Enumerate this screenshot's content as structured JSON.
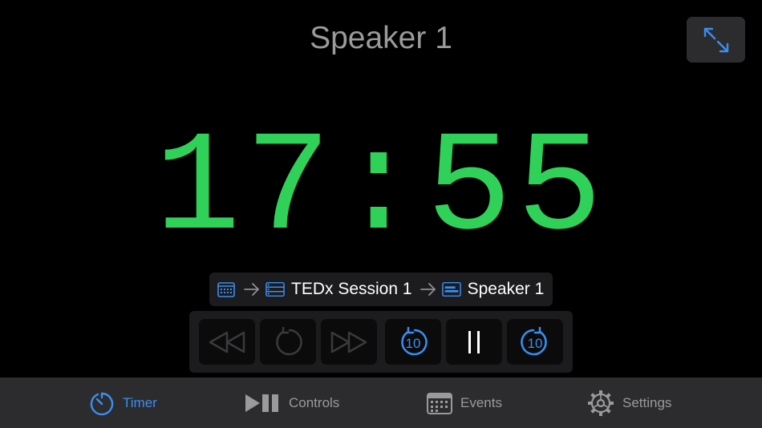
{
  "header": {
    "speaker_title": "Speaker 1"
  },
  "timer": {
    "display": "17:55",
    "color": "#30d158"
  },
  "breadcrumb": {
    "session": "TEDx Session 1",
    "speaker": "Speaker 1"
  },
  "controls": [
    {
      "name": "rewind",
      "icon": "rewind-icon",
      "enabled": false
    },
    {
      "name": "reset",
      "icon": "reset-icon",
      "enabled": false
    },
    {
      "name": "fast-forward",
      "icon": "fast-forward-icon",
      "enabled": false
    },
    {
      "name": "back-10",
      "icon": "back-10-icon",
      "label": "10",
      "enabled": true
    },
    {
      "name": "pause",
      "icon": "pause-icon",
      "enabled": true
    },
    {
      "name": "forward-10",
      "icon": "forward-10-icon",
      "label": "10",
      "enabled": true
    }
  ],
  "tabs": [
    {
      "label": "Timer",
      "icon": "stopwatch-icon",
      "active": true
    },
    {
      "label": "Controls",
      "icon": "play-pause-icon",
      "active": false
    },
    {
      "label": "Events",
      "icon": "calendar-icon",
      "active": false
    },
    {
      "label": "Settings",
      "icon": "gear-icon",
      "active": false
    }
  ],
  "colors": {
    "accent": "#3a8ef0",
    "background": "#000000",
    "panel": "#1c1c1e",
    "tab_bar": "#2c2c2e",
    "disabled_icon": "#3a3a3c"
  }
}
